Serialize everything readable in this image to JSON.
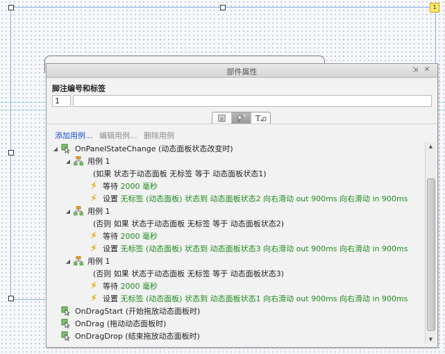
{
  "canvas": {
    "badge_number": "1"
  },
  "panel": {
    "title": "部件属性",
    "section_label": "脚注编号和标签",
    "footnote_number": "1",
    "footnote_label": "",
    "actions": {
      "add": "添加用例...",
      "edit": "编辑用例...",
      "delete": "删除用例"
    }
  },
  "tree": {
    "event1": {
      "label": "OnPanelStateChange (动态面板状态改变时)"
    },
    "case1": {
      "label": "用例 1",
      "condition": "(如果 状态于动态面板 无标签 等于 动态面板状态1)",
      "wait": {
        "label": "等待",
        "value": "2000 毫秒"
      },
      "set": {
        "label": "设置",
        "value": "无标签 (动态面板) 状态到 动态面板状态2 向右滑动 out 900ms 向右滑动 in 900ms"
      }
    },
    "case2": {
      "label": "用例 1",
      "condition": "(否则 如果 状态于动态面板 无标签 等于 动态面板状态2)",
      "wait": {
        "label": "等待",
        "value": "2000 毫秒"
      },
      "set": {
        "label": "设置",
        "value": "无标签 (动态面板) 状态到 动态面板状态3 向右滑动 out 900ms 向右滑动 in 900ms"
      }
    },
    "case3": {
      "label": "用例 1",
      "condition": "(否则 如果 状态于动态面板 无标签 等于 动态面板状态3)",
      "wait": {
        "label": "等待",
        "value": "2000 毫秒"
      },
      "set": {
        "label": "设置",
        "value": "无标签 (动态面板) 状态到 动态面板状态1 向右滑动 out 900ms 向右滑动 in 900ms"
      }
    },
    "event2": {
      "label": "OnDragStart (开始拖放动态面板时)"
    },
    "event3": {
      "label": "OnDrag (拖动动态面板时)"
    },
    "event4": {
      "label": "OnDragDrop (结束拖放动态面板时)"
    }
  },
  "colors": {
    "link": "#1a4fcf",
    "action_value": "#1e8a1e",
    "selection": "#8ab0e8"
  },
  "icons": [
    "minimize-icon",
    "close-icon",
    "notes-tab-icon",
    "interactions-tab-icon",
    "text-tab-icon",
    "event-icon",
    "case-icon",
    "action-bolt-icon"
  ]
}
